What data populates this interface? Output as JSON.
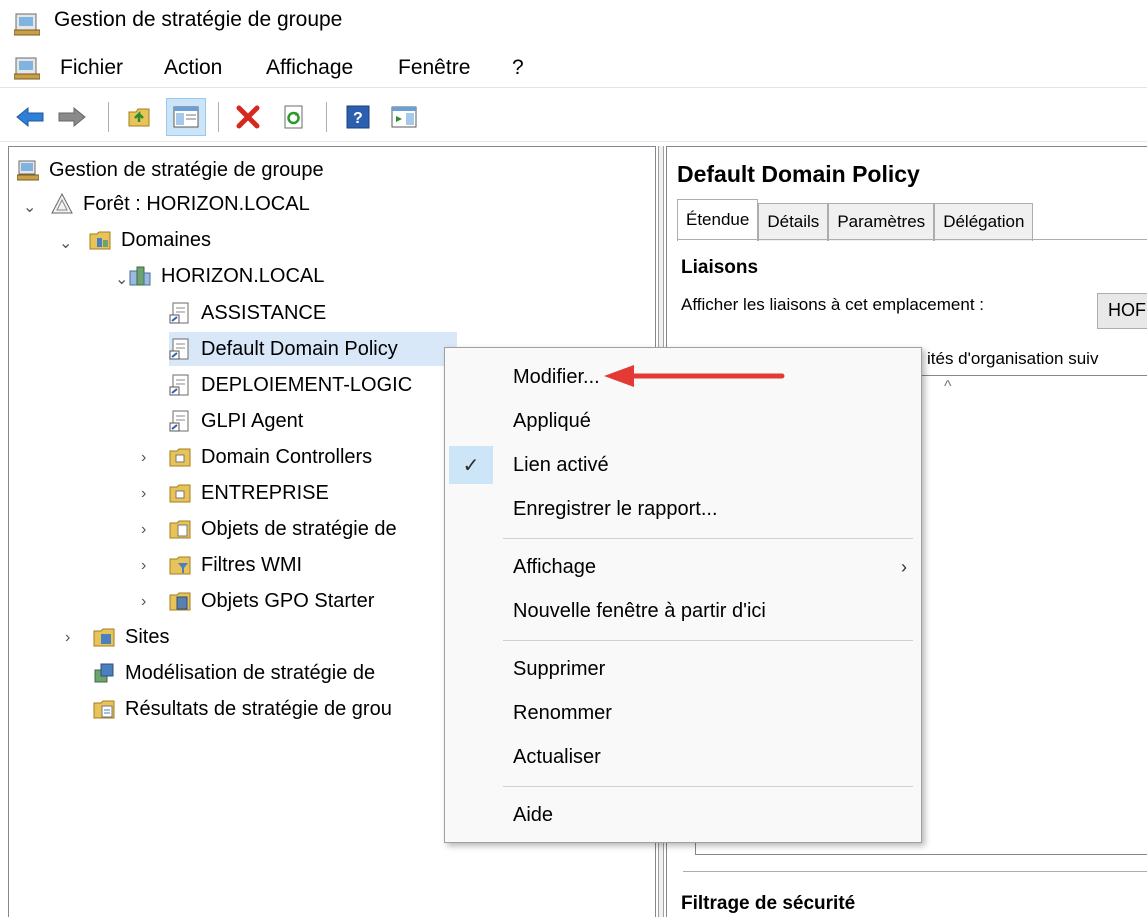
{
  "window": {
    "title": "Gestion de stratégie de groupe"
  },
  "menubar": {
    "items": [
      "Fichier",
      "Action",
      "Affichage",
      "Fenêtre",
      "?"
    ]
  },
  "toolbar": {
    "buttons": [
      "back-icon",
      "forward-icon",
      "up-folder-icon",
      "show-hide-console-tree-icon",
      "delete-icon",
      "refresh-icon",
      "help-icon",
      "show-action-pane-icon"
    ],
    "active_button": "show-hide-console-tree-icon"
  },
  "tree": {
    "root": "Gestion de stratégie de groupe",
    "forest": "Forêt : HORIZON.LOCAL",
    "domains": "Domaines",
    "domain": "HORIZON.LOCAL",
    "gpo_links": [
      "ASSISTANCE",
      "Default Domain Policy",
      "DEPLOIEMENT-LOGIC",
      "GLPI Agent"
    ],
    "selected": "Default Domain Policy",
    "containers": [
      "Domain Controllers",
      "ENTREPRISE",
      "Objets de stratégie de",
      "Filtres WMI",
      "Objets GPO Starter"
    ],
    "sites": "Sites",
    "modeling": "Modélisation de stratégie de",
    "results": "Résultats de stratégie de grou"
  },
  "right_pane": {
    "title": "Default Domain Policy",
    "tabs": [
      "Étendue",
      "Détails",
      "Paramètres",
      "Délégation"
    ],
    "active_tab": "Étendue",
    "links_heading": "Liaisons",
    "show_links_label": "Afficher les liaisons à cet emplacement :",
    "location_value": "HOF",
    "linked_text": "ités d'organisation suiv",
    "security_filtering_heading": "Filtrage de sécurité"
  },
  "context_menu": {
    "items": [
      {
        "label": "Modifier..."
      },
      {
        "label": "Appliqué"
      },
      {
        "label": "Lien activé",
        "checked": true
      },
      {
        "label": "Enregistrer le rapport..."
      },
      {
        "label": "Affichage",
        "submenu": true
      },
      {
        "label": "Nouvelle fenêtre à partir d'ici"
      },
      {
        "label": "Supprimer"
      },
      {
        "label": "Renommer"
      },
      {
        "label": "Actualiser"
      },
      {
        "label": "Aide"
      }
    ]
  },
  "annotation": {
    "arrow_color": "#e53935",
    "points_to": "Modifier..."
  },
  "colors": {
    "selection": "#d9e8f8",
    "menu_check_bg": "#cde6f7",
    "toolbar_active": "#cce4f7"
  }
}
